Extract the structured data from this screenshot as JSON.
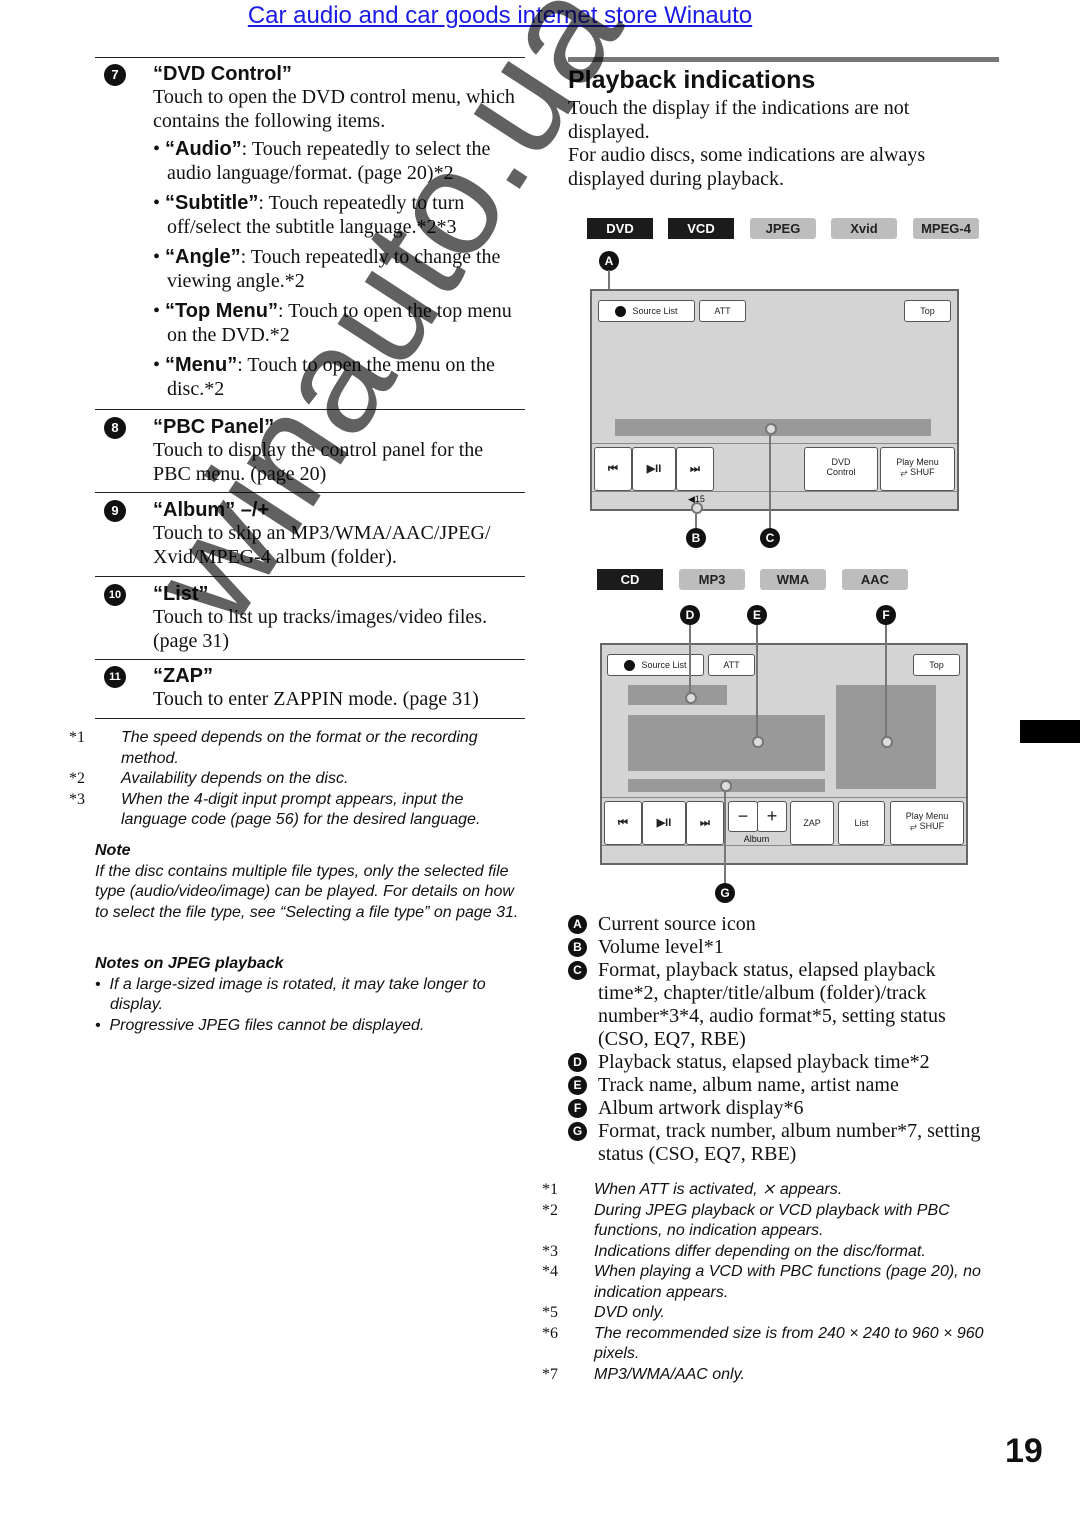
{
  "header_link": "Car audio and car goods internet store Winauto",
  "left": {
    "items": [
      {
        "num": "7",
        "title": "“DVD Control”",
        "desc": "Touch to open the DVD control menu, which contains the following items.",
        "bullets": [
          {
            "term": "“Audio”",
            "text": ": Touch repeatedly to select the audio language/format. (page 20)*2"
          },
          {
            "term": "“Subtitle”",
            "text": ": Touch repeatedly to turn off/select the subtitle language.*2*3"
          },
          {
            "term": "“Angle”",
            "text": ": Touch repeatedly to change the viewing angle.*2"
          },
          {
            "term": "“Top Menu”",
            "text": ": Touch to open the top menu on the DVD.*2"
          },
          {
            "term": "“Menu”",
            "text": ": Touch to open the menu on the disc.*2"
          }
        ]
      },
      {
        "num": "8",
        "title": "“PBC Panel”",
        "desc": "Touch to display the control panel for the PBC menu. (page 20)"
      },
      {
        "num": "9",
        "title": "“Album” –/+",
        "desc": "Touch to skip an MP3/WMA/AAC/JPEG/ Xvid/MPEG-4 album (folder)."
      },
      {
        "num": "10",
        "title": "“List”",
        "desc": "Touch to list up tracks/images/video files. (page 31)"
      },
      {
        "num": "11",
        "title": "“ZAP”",
        "desc": "Touch to enter ZAPPIN mode. (page 31)"
      }
    ],
    "footnotes": [
      {
        "mark": "*1",
        "text": "The speed depends on the format or the recording method."
      },
      {
        "mark": "*2",
        "text": "Availability depends on the disc."
      },
      {
        "mark": "*3",
        "text": "When the 4-digit input prompt appears, input the language code (page 56) for the desired language."
      }
    ],
    "note_title": "Note",
    "note_text": "If the disc contains multiple file types, only the selected file type (audio/video/image) can be played. For details on how to select the file type, see “Selecting a file type” on page 31.",
    "jpeg_title": "Notes on JPEG playback",
    "jpeg_bullets": [
      "If a large-sized image is rotated, it may take longer to display.",
      "Progressive JPEG files cannot be displayed."
    ]
  },
  "right": {
    "title": "Playback indications",
    "intro1": "Touch the display if the indications are not displayed.",
    "intro2": "For audio discs, some indications are always displayed during playback.",
    "video_badges": [
      "DVD",
      "VCD",
      "JPEG",
      "Xvid",
      "MPEG-4"
    ],
    "audio_badges": [
      "CD",
      "MP3",
      "WMA",
      "AAC"
    ],
    "screen1": {
      "source_list": "Source List",
      "att": "ATT",
      "top": "Top",
      "prev": "⏮",
      "play_pause": "▶II",
      "next": "⏭",
      "dvd_control_1": "DVD",
      "dvd_control_2": "Control",
      "play_menu": "Play Menu",
      "shuf": "⥂ SHUF",
      "volume": "15"
    },
    "screen2": {
      "source_list": "Source List",
      "att": "ATT",
      "top": "Top",
      "minus": "−",
      "plus": "+",
      "album": "Album",
      "zap": "ZAP",
      "list": "List",
      "play_menu": "Play Menu",
      "shuf": "⥂ SHUF"
    },
    "callouts": [
      "A",
      "B",
      "C",
      "D",
      "E",
      "F",
      "G"
    ],
    "legend": [
      {
        "key": "A",
        "text": "Current source icon"
      },
      {
        "key": "B",
        "text": "Volume level*1"
      },
      {
        "key": "C",
        "text": "Format, playback status, elapsed playback time*2, chapter/title/album (folder)/track number*3*4, audio format*5, setting status (CSO, EQ7, RBE)"
      },
      {
        "key": "D",
        "text": "Playback status, elapsed playback time*2"
      },
      {
        "key": "E",
        "text": "Track name, album name, artist name"
      },
      {
        "key": "F",
        "text": "Album artwork display*6"
      },
      {
        "key": "G",
        "text": "Format, track number, album number*7, setting status (CSO, EQ7, RBE)"
      }
    ],
    "footnotes": [
      {
        "mark": "*1",
        "text": "When ATT is activated, ⨯ appears."
      },
      {
        "mark": "*2",
        "text": "During JPEG playback or VCD playback with PBC functions, no indication appears."
      },
      {
        "mark": "*3",
        "text": "Indications differ depending on the disc/format."
      },
      {
        "mark": "*4",
        "text": "When playing a VCD with PBC functions (page 20), no indication appears."
      },
      {
        "mark": "*5",
        "text": "DVD only."
      },
      {
        "mark": "*6",
        "text": "The recommended size is from 240 × 240 to 960 × 960 pixels."
      },
      {
        "mark": "*7",
        "text": "MP3/WMA/AAC only."
      }
    ]
  },
  "watermark": "winauto.ua",
  "page_number": "19"
}
